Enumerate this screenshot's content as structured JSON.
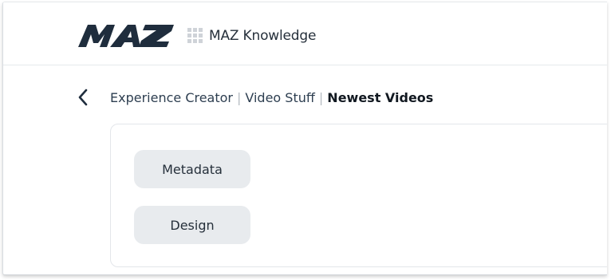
{
  "header": {
    "logo_text": "MAZ",
    "app_title": "MAZ Knowledge",
    "apps_icon": "grid-apps-icon"
  },
  "navigation": {
    "back_icon": "chevron-left-icon",
    "breadcrumb": [
      {
        "label": "Experience Creator"
      },
      {
        "label": "Video Stuff"
      },
      {
        "label": "Newest Videos"
      }
    ],
    "separator": "|"
  },
  "panel": {
    "buttons": [
      {
        "label": "Metadata"
      },
      {
        "label": "Design"
      }
    ]
  },
  "colors": {
    "brand": "#1f2d3d",
    "button_bg": "#e8ebee",
    "separator": "#b6bcc3"
  }
}
